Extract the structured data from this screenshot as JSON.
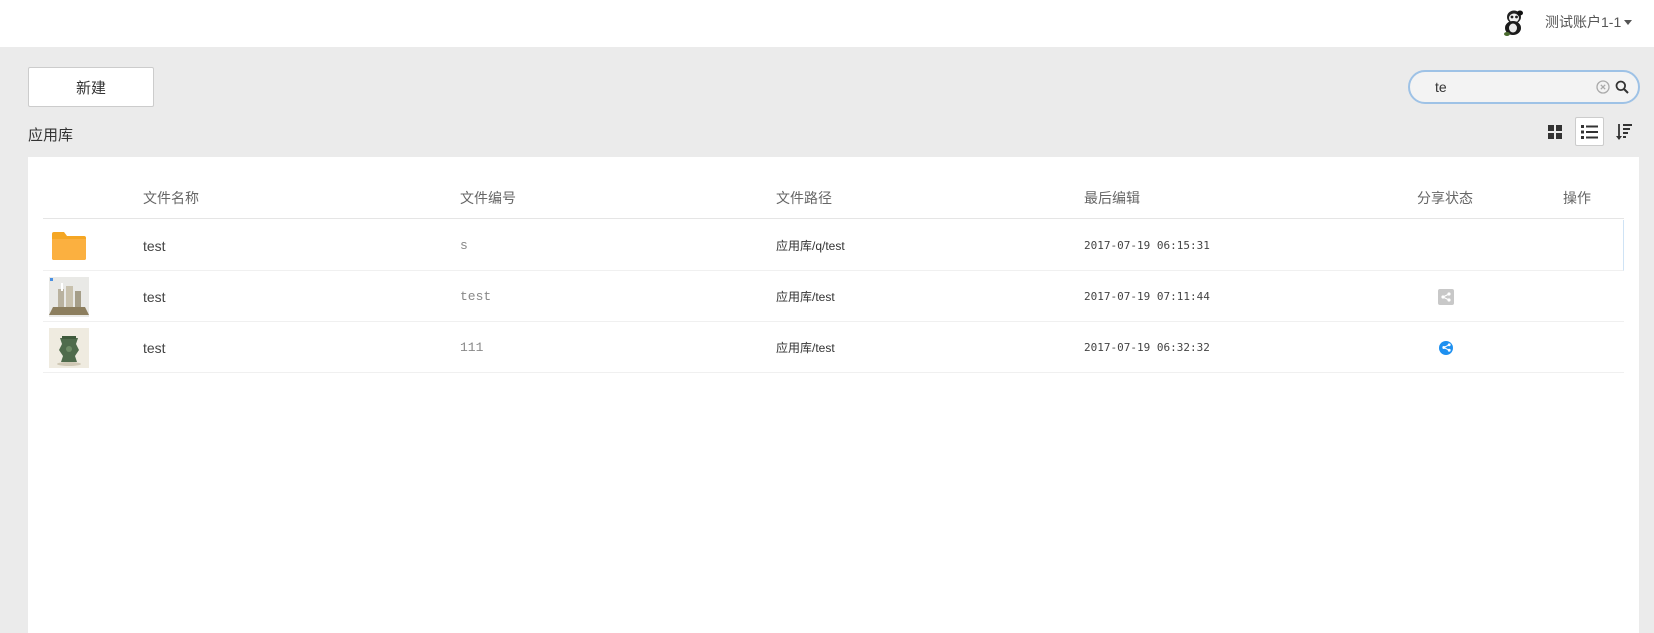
{
  "header": {
    "account_name": "测试账户1-1"
  },
  "toolbar": {
    "new_label": "新建",
    "search_value": "te"
  },
  "library": {
    "title": "应用库"
  },
  "table": {
    "columns": [
      "文件名称",
      "文件编号",
      "文件路径",
      "最后编辑",
      "分享状态",
      "操作"
    ],
    "rows": [
      {
        "name": "test",
        "number": "s",
        "path": "应用库/q/test",
        "edited": "2017-07-19 06:15:31",
        "type": "folder",
        "share": "none"
      },
      {
        "name": "test",
        "number": "test",
        "path": "应用库/test",
        "edited": "2017-07-19 07:11:44",
        "type": "image",
        "share": "not-shared"
      },
      {
        "name": "test",
        "number": "111",
        "path": "应用库/test",
        "edited": "2017-07-19 06:32:32",
        "type": "image",
        "share": "shared"
      }
    ]
  },
  "colors": {
    "folder": "#fbb040",
    "share_active": "#1e90f0",
    "share_inactive": "#c8c8c8",
    "search_border": "#9ec2e6"
  },
  "icons": {
    "avatar": "panda-avatar-icon",
    "clear": "clear-circle-icon",
    "search": "magnifier-icon",
    "grid_view": "grid-view-icon",
    "list_view": "list-view-icon",
    "sort": "sort-icon",
    "folder": "folder-icon",
    "share": "share-icon"
  }
}
